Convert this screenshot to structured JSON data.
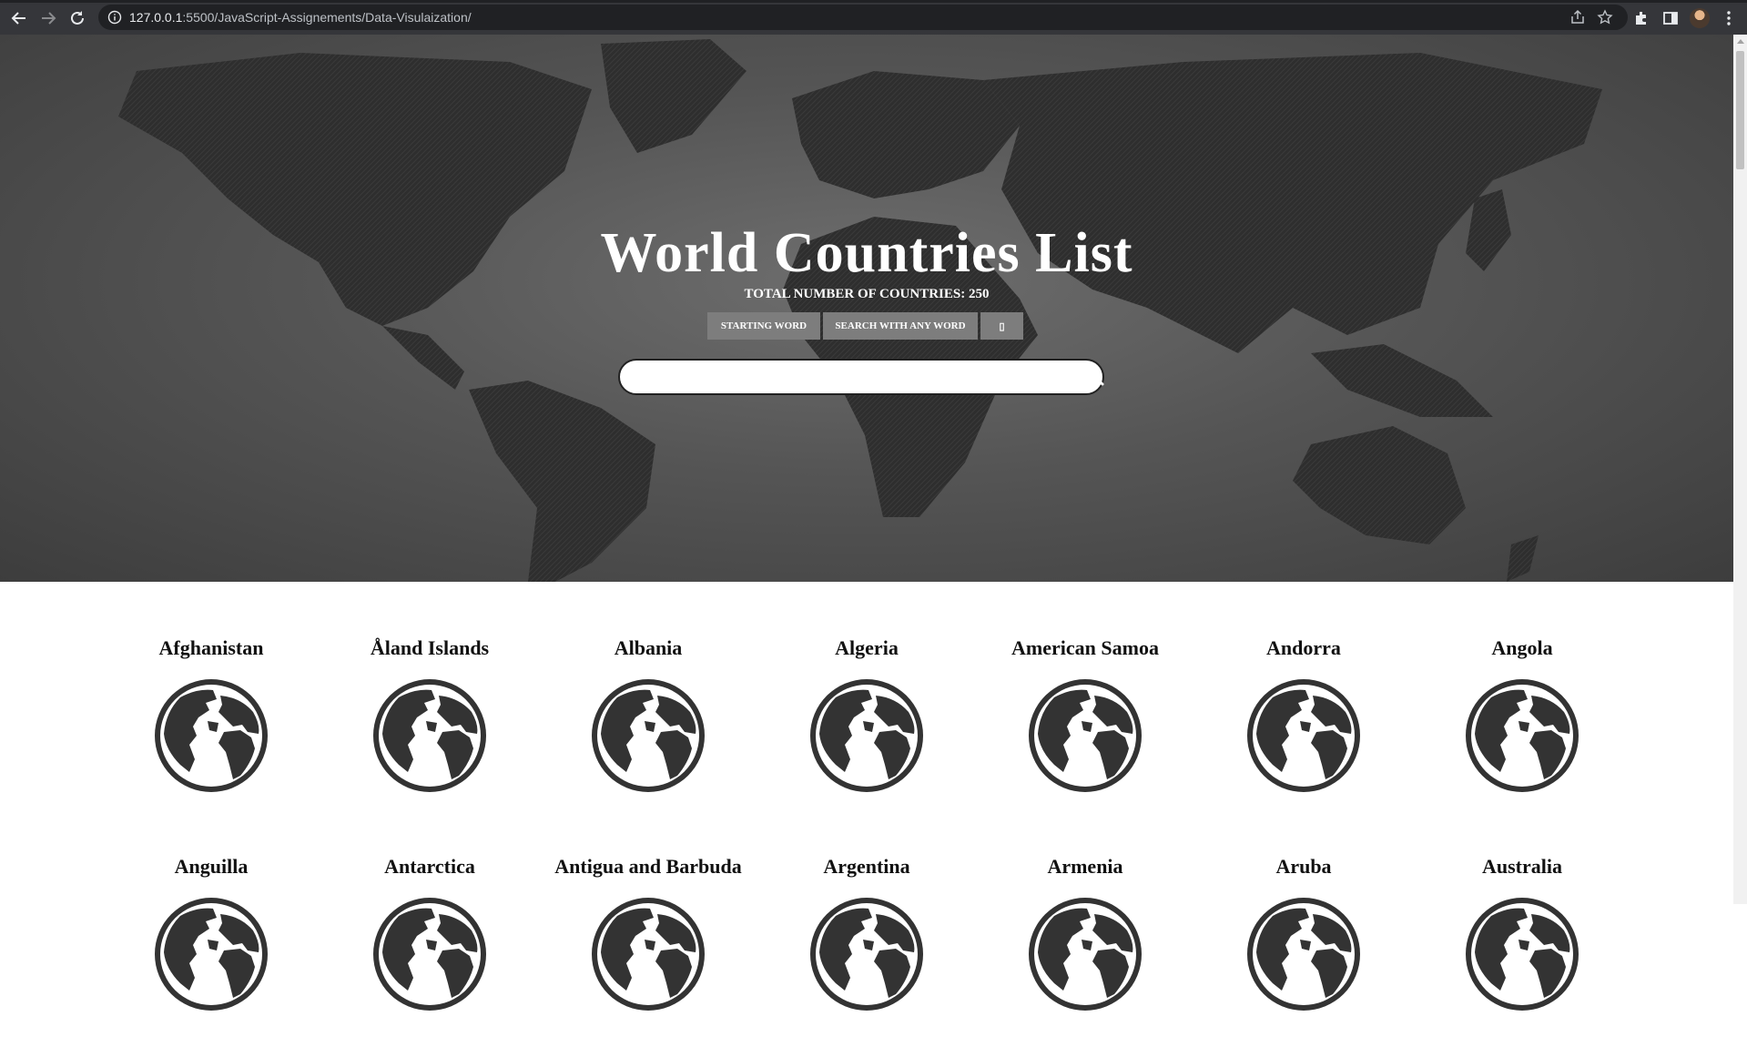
{
  "browser": {
    "url_host": "127.0.0.1",
    "url_path": ":5500/JavaScript-Assignements/Data-Visulaization/",
    "icons": [
      "back-icon",
      "forward-icon",
      "reload-icon",
      "info-icon",
      "share-icon",
      "star-icon",
      "extensions-icon",
      "side-panel-icon",
      "avatar",
      "menu-icon"
    ]
  },
  "hero": {
    "title": "World Countries List",
    "count_text": "TOTAL NUMBER OF COUNTRIES: 250",
    "buttons": {
      "starting_word": "STARTING WORD",
      "any_word": "SEARCH WITH ANY WORD",
      "sort": "▯"
    },
    "search": {
      "value": "",
      "placeholder": ""
    }
  },
  "countries": [
    "Afghanistan",
    "Åland Islands",
    "Albania",
    "Algeria",
    "American Samoa",
    "Andorra",
    "Angola",
    "Anguilla",
    "Antarctica",
    "Antigua and Barbuda",
    "Argentina",
    "Armenia",
    "Aruba",
    "Australia"
  ],
  "colors": {
    "chrome_bg": "#35363a",
    "hero_bg": "#555555",
    "land": "#2c2c2c",
    "button_bg": "#7d7d7d",
    "globe": "#333333"
  }
}
